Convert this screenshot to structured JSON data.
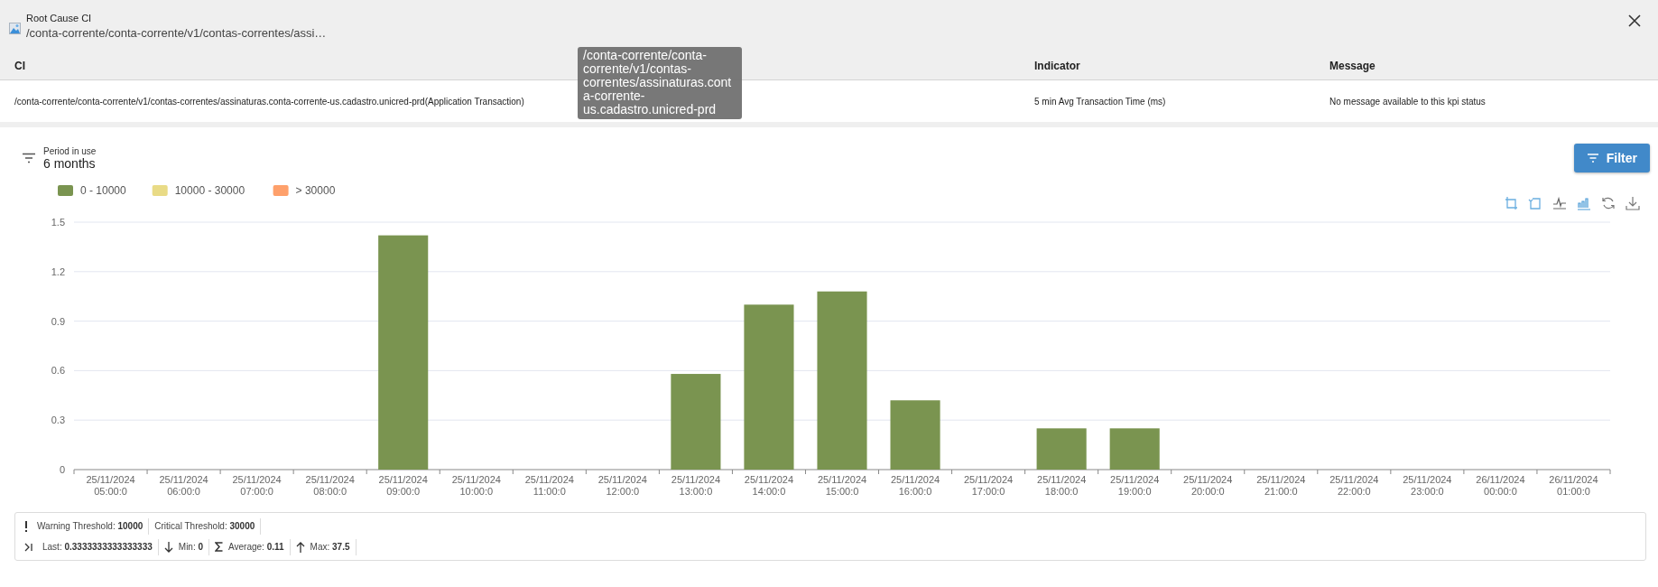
{
  "header": {
    "title": "Root Cause CI",
    "subtitle": "/conta-corrente/conta-corrente/v1/contas-correntes/assi…"
  },
  "table": {
    "columns": [
      "CI",
      "Indicator",
      "Message"
    ],
    "rows": [
      [
        "/conta-corrente/conta-corrente/v1/contas-correntes/assinaturas.conta-corrente-us.cadastro.unicred-prd(Application Transaction)",
        "5 min Avg Transaction Time (ms)",
        "No message available to this kpi status"
      ]
    ]
  },
  "tooltip": "/conta-corrente/conta-corrente/v1/contas-correntes/assinaturas.conta-corrente-us.cadastro.unicred-prd",
  "period": {
    "label": "Period in use",
    "value": "6 months"
  },
  "filter_button": "Filter",
  "chart_data": {
    "type": "bar",
    "categories": [
      "25/11/2024 05:00:0",
      "25/11/2024 06:00:0",
      "25/11/2024 07:00:0",
      "25/11/2024 08:00:0",
      "25/11/2024 09:00:0",
      "25/11/2024 10:00:0",
      "25/11/2024 11:00:0",
      "25/11/2024 12:00:0",
      "25/11/2024 13:00:0",
      "25/11/2024 14:00:0",
      "25/11/2024 15:00:0",
      "25/11/2024 16:00:0",
      "25/11/2024 17:00:0",
      "25/11/2024 18:00:0",
      "25/11/2024 19:00:0",
      "25/11/2024 20:00:0",
      "25/11/2024 21:00:0",
      "25/11/2024 22:00:0",
      "25/11/2024 23:00:0",
      "26/11/2024 00:00:0",
      "26/11/2024 01:00:0"
    ],
    "series": [
      {
        "name": "0 - 10000",
        "color": "#7a9450",
        "values": [
          0,
          0,
          0,
          0,
          1.42,
          0,
          0,
          0,
          0.58,
          1.0,
          1.08,
          0.42,
          0,
          0.25,
          0.25,
          0,
          0,
          0,
          0,
          0,
          0
        ]
      },
      {
        "name": "10000 - 30000",
        "color": "#e9db86",
        "values": [
          null,
          null,
          null,
          null,
          null,
          null,
          null,
          null,
          null,
          null,
          null,
          null,
          null,
          null,
          null,
          null,
          null,
          null,
          null,
          null,
          null
        ]
      },
      {
        "name": "> 30000",
        "color": "#fea06b",
        "values": [
          null,
          null,
          null,
          null,
          null,
          null,
          null,
          null,
          null,
          null,
          null,
          null,
          null,
          null,
          null,
          null,
          null,
          null,
          null,
          null,
          null
        ]
      }
    ],
    "grid": true,
    "ylim": [
      0,
      1.5
    ],
    "yticks": [
      0,
      0.3,
      0.6,
      0.9,
      1.2,
      1.5
    ],
    "stacked": true
  },
  "stats": {
    "rows": [
      [
        {
          "label": "Warning Threshold:",
          "value": "10000"
        },
        {
          "label": "Critical Threshold:",
          "value": "30000"
        }
      ],
      [
        {
          "label": "Last:",
          "value": "0.3333333333333333"
        },
        {
          "label": "Min:",
          "value": "0"
        },
        {
          "label": "Average:",
          "value": "0.11"
        },
        {
          "label": "Max:",
          "value": "37.5"
        }
      ]
    ]
  }
}
